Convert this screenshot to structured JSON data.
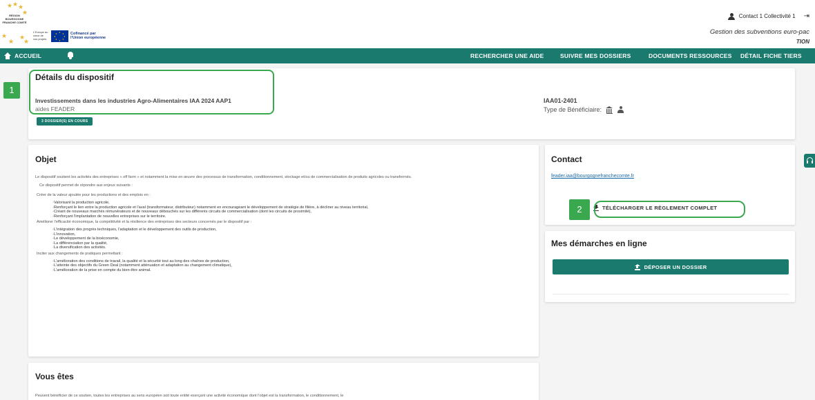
{
  "header": {
    "logo_region_text": "RÉGION BOURGOGNE FRANCHE COMTÉ",
    "logo_europe_text": "L'Europe au cœur de vos projets",
    "cofinance_line1": "Cofinancé par",
    "cofinance_line2": "l'Union européenne",
    "user_name": "Contact 1 Collectivité 1",
    "app_title": "Gestion des subventions euro-pac",
    "app_title_suffix": "TION"
  },
  "nav": {
    "home": "ACCUEIL",
    "rechercher": "RECHERCHER UNE AIDE",
    "suivre": "SUIVRE MES DOSSIERS",
    "documents": "DOCUMENTS RESSOURCES",
    "detail_tiers": "DÉTAIL FICHE TIERS"
  },
  "annotations": {
    "one": "1",
    "two": "2"
  },
  "details": {
    "title": "Détails du dispositif",
    "name": "Investissements dans les industries Agro-Alimentaires IAA 2024 AAP1",
    "aides": "aides FEADER",
    "badge": "3 DOSSIER(S) EN COURS",
    "code": "IAA01-2401",
    "type_label": "Type de Bénéficiaire:"
  },
  "objet": {
    "title": "Objet",
    "intro": "Le dispositif soutient les activités des entreprises « off farm » et notamment la mise en œuvre des processus de transformation, conditionnement, stockage et/ou de commercialisation de produits agricoles ou transformés.",
    "enjeux": "Ce dispositif permet de répondre aux enjeux suivants :",
    "creer": "Créer de la valeur ajoutée pour les productions et des emplois en :",
    "creer_items": [
      "Valorisant la production agricole,",
      "Renforçant le lien entre la production agricole et l'aval (transformateur, distributeur) notamment en encourageant le développement de stratégie de filière, à décliner au niveau territorial,",
      "Créant de nouveaux marchés rémunérateurs et de nouveaux débouchés sur les différents circuits de commercialisation (dont les circuits de proximité),",
      "Renforçant l'implantation de nouvelles entreprises sur le territoire."
    ],
    "ameliorer": "Améliorer l'efficacité économique, la compétitivité et la résilience des entreprises des secteurs concernés par le dispositif par :",
    "ameliorer_items": [
      "L'intégration des progrès techniques, l'adaptation et le développement des outils de production,",
      "L'innovation,",
      "Le développement de la bioéconomie,",
      "La différenciation par la qualité,",
      "La diversification des activités."
    ],
    "inciter": "Inciter aux changements de pratiques permettant :",
    "inciter_items": [
      "L'amélioration des conditions de travail, la qualité et la sécurité tout au long des chaînes de production,",
      "L'atteinte des objectifs du Green Deal (notamment atténuation et adaptation au changement climatique),",
      "L'amélioration de la prise en compte du bien-être animal."
    ]
  },
  "contact": {
    "title": "Contact",
    "email": "feader.iaa@bourgognefranchecomte.fr",
    "download": "TÉLÉCHARGER LE RÈGLEMENT COMPLET"
  },
  "demarches": {
    "title": "Mes démarches en ligne",
    "deposer": "DÉPOSER UN DOSSIER"
  },
  "vous": {
    "title": "Vous êtes",
    "text": "Peuvent bénéficier de ce soutien, toutes les entreprises au sens européen soit toute entité exerçant une activité économique dont l'objet est la transformation, le conditionnement, le"
  },
  "colors": {
    "primary": "#1a7a6e",
    "annotation": "#3aa84f",
    "link": "#1a6aa8"
  }
}
